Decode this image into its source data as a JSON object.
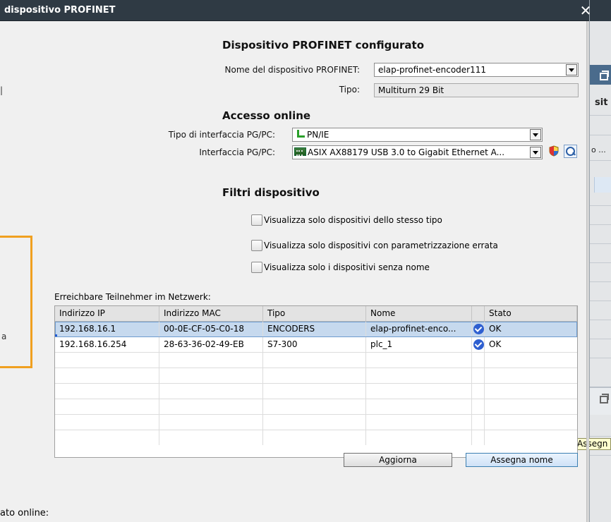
{
  "dialog": {
    "title": "dispositivo PROFINET",
    "close_glyph": "✕"
  },
  "configured": {
    "heading": "Dispositivo PROFINET configurato",
    "device_name_label": "Nome del dispositivo PROFINET:",
    "device_name_value": "elap-profinet-encoder111",
    "type_label": "Tipo:",
    "type_value": "Multiturn 29 Bit"
  },
  "online": {
    "heading": "Accesso online",
    "iface_type_label": "Tipo di interfaccia PG/PC:",
    "iface_type_value": "PN/IE",
    "iface_label": "Interfaccia PG/PC:",
    "iface_value": "ASIX AX88179 USB 3.0 to Gigabit Ethernet A..."
  },
  "filters": {
    "heading": "Filtri dispositivo",
    "options": [
      {
        "label": "Visualizza solo dispositivi dello stesso tipo",
        "checked": false
      },
      {
        "label": "Visualizza solo dispositivi con parametrizzazione errata",
        "checked": false
      },
      {
        "label": "Visualizza solo i dispositivi senza nome",
        "checked": false
      }
    ]
  },
  "network": {
    "caption": "Erreichbare Teilnehmer im Netzwerk:",
    "columns": [
      "Indirizzo IP",
      "Indirizzo MAC",
      "Tipo",
      "Nome",
      "Stato"
    ],
    "rows": [
      {
        "ip": "192.168.16.1",
        "mac": "00-0E-CF-05-C0-18",
        "type": "ENCODERS",
        "name": "elap-profinet-enco...",
        "status_icon": "ok-check-icon",
        "status": "OK",
        "selected": true
      },
      {
        "ip": "192.168.16.254",
        "mac": "28-63-36-02-49-EB",
        "type": "S7-300",
        "name": "plc_1",
        "status_icon": "ok-check-icon",
        "status": "OK",
        "selected": false
      }
    ]
  },
  "buttons": {
    "refresh": "Aggiorna",
    "assign_name": "Assegna nome"
  },
  "footer": {
    "label": "ato online:"
  },
  "background": {
    "text_sit": "sit",
    "text_o": "o ...",
    "tooltip": "Assegn"
  },
  "colors": {
    "titlebar": "#2f3a44",
    "selection": "#c6d9ee",
    "accent_frame": "#f0a020",
    "ok_icon": "#2e5fd0",
    "pnie_green": "#2aa02a"
  }
}
